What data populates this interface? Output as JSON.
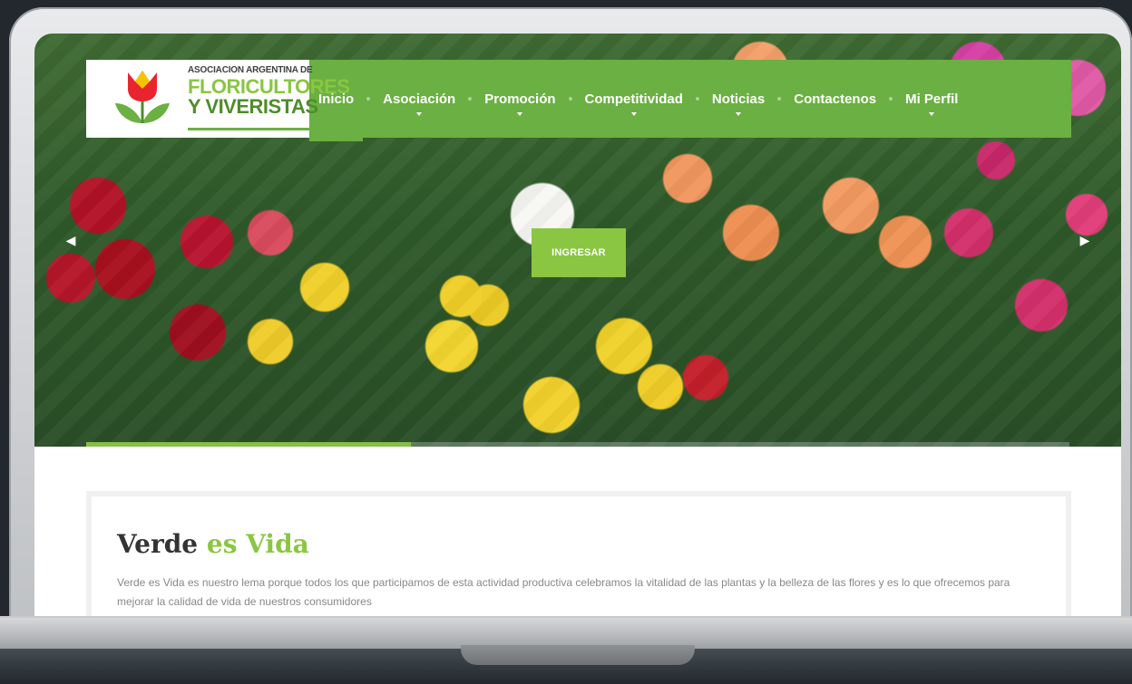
{
  "header": {
    "logo": {
      "line1": "ASOCIACION ARGENTINA DE",
      "line2": "FLORICULTORES",
      "line3": "Y VIVERISTAS"
    },
    "nav": [
      {
        "label": "Inicio",
        "has_dropdown": false,
        "active": true
      },
      {
        "label": "Asociación",
        "has_dropdown": true,
        "active": false
      },
      {
        "label": "Promoción",
        "has_dropdown": true,
        "active": false
      },
      {
        "label": "Competitividad",
        "has_dropdown": true,
        "active": false
      },
      {
        "label": "Noticias",
        "has_dropdown": true,
        "active": false
      },
      {
        "label": "Contactenos",
        "has_dropdown": false,
        "active": false
      },
      {
        "label": "Mi Perfil",
        "has_dropdown": true,
        "active": false
      }
    ]
  },
  "hero": {
    "cta_label": "INGRESAR",
    "prev_icon": "chevron-left-icon",
    "next_icon": "chevron-right-icon",
    "slide_progress": 0.33
  },
  "intro": {
    "title_plain": "Verde",
    "title_accent": "es Vida",
    "text": "Verde es Vida es nuestro lema porque todos los que participamos de esta actividad productiva celebramos la vitalidad de las plantas y la belleza de las flores y es lo que ofrecemos para mejorar la calidad de vida de nuestros consumidores"
  },
  "colors": {
    "brand_green": "#6ab042",
    "accent_green": "#8ac642",
    "logo_tulip_red": "#e8242f",
    "logo_tulip_yellow": "#f5c400"
  }
}
